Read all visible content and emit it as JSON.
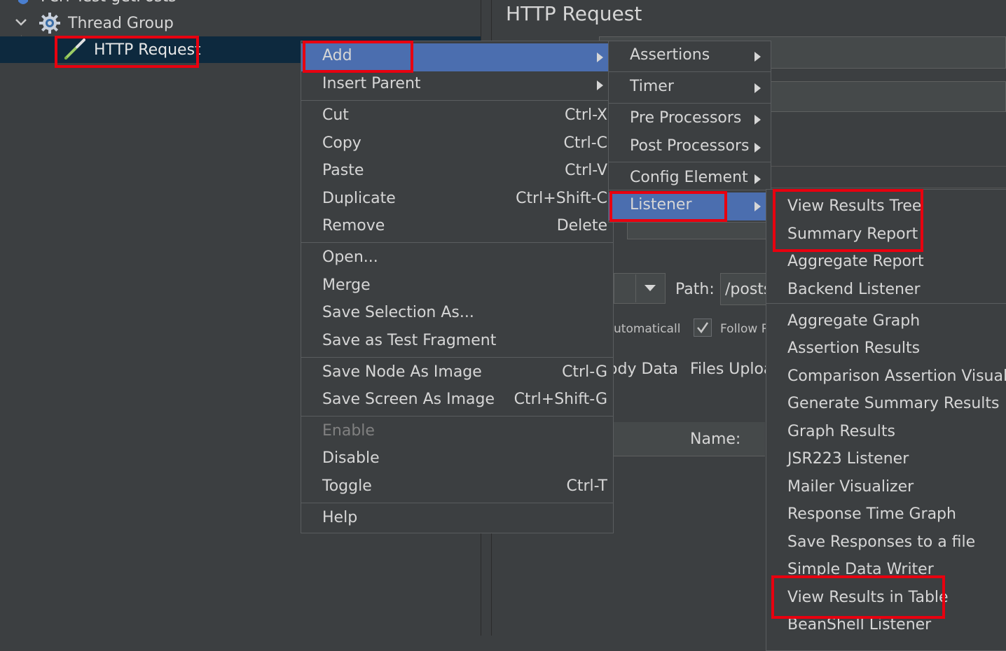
{
  "tree": {
    "root_label": "Perf Test getPosts",
    "thread_group_label": "Thread Group",
    "selected_label": "HTTP Request"
  },
  "panel": {
    "title": "HTTP Request",
    "path_label": "Path:",
    "path_value": "/posts",
    "auto_label": "utomatically",
    "follow_label": "Follow R",
    "tab_body": "Body Data",
    "tab_files": "Files Upload",
    "name_label": "Name:"
  },
  "context_menu": {
    "items": [
      {
        "label": "Add",
        "shortcut": "",
        "submenu": true
      },
      {
        "label": "Insert Parent",
        "shortcut": "",
        "submenu": true
      },
      {
        "label": "Cut",
        "shortcut": "Ctrl-X"
      },
      {
        "label": "Copy",
        "shortcut": "Ctrl-C"
      },
      {
        "label": "Paste",
        "shortcut": "Ctrl-V"
      },
      {
        "label": "Duplicate",
        "shortcut": "Ctrl+Shift-C"
      },
      {
        "label": "Remove",
        "shortcut": "Delete"
      },
      {
        "label": "Open...",
        "shortcut": ""
      },
      {
        "label": "Merge",
        "shortcut": ""
      },
      {
        "label": "Save Selection As...",
        "shortcut": ""
      },
      {
        "label": "Save as Test Fragment",
        "shortcut": ""
      },
      {
        "label": "Save Node As Image",
        "shortcut": "Ctrl-G"
      },
      {
        "label": "Save Screen As Image",
        "shortcut": "Ctrl+Shift-G"
      },
      {
        "label": "Enable",
        "shortcut": "",
        "disabled": true
      },
      {
        "label": "Disable",
        "shortcut": ""
      },
      {
        "label": "Toggle",
        "shortcut": "Ctrl-T"
      },
      {
        "label": "Help",
        "shortcut": ""
      }
    ]
  },
  "add_submenu": {
    "items": [
      "Assertions",
      "Timer",
      "Pre Processors",
      "Post Processors",
      "Config Element",
      "Listener"
    ]
  },
  "listener_submenu": {
    "items": [
      "View Results Tree",
      "Summary Report",
      "Aggregate Report",
      "Backend Listener",
      "Aggregate Graph",
      "Assertion Results",
      "Comparison Assertion Visualizer",
      "Generate Summary Results",
      "Graph Results",
      "JSR223 Listener",
      "Mailer Visualizer",
      "Response Time Graph",
      "Save Responses to a file",
      "Simple Data Writer",
      "View Results in Table",
      "BeanShell Listener"
    ]
  },
  "colors": {
    "background": "#3c3f41",
    "selection": "#4b6eaf",
    "highlight_box": "#e8000f"
  }
}
